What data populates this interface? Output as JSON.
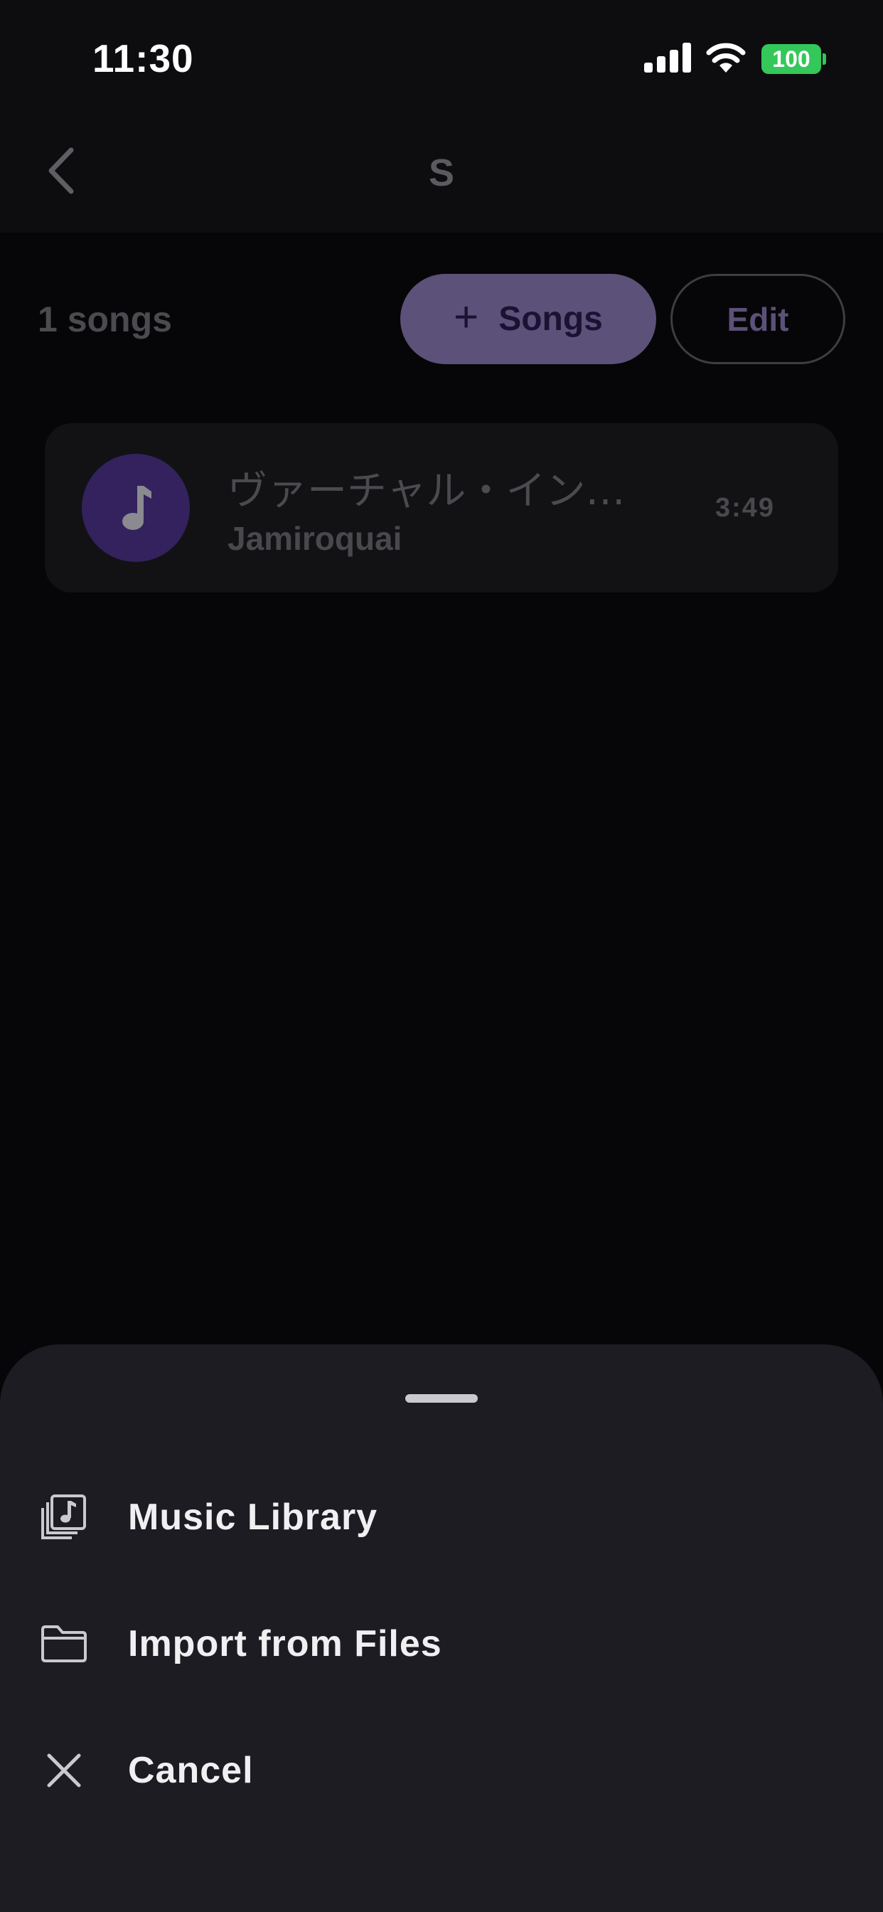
{
  "status_bar": {
    "time": "11:30",
    "battery": "100",
    "battery_color": "#34c759"
  },
  "nav": {
    "title": "S",
    "back_icon": "chevron-left-icon"
  },
  "toolbar": {
    "song_count": "1 songs",
    "add_songs_label": "Songs",
    "add_songs_icon": "plus-icon",
    "edit_label": "Edit",
    "accent": "#5c5178"
  },
  "songs": [
    {
      "title": "ヴァーチャル・イン…",
      "artist": "Jamiroquai",
      "duration": "3:49",
      "artwork_icon": "music-note-icon"
    }
  ],
  "sheet": {
    "items": [
      {
        "label": "Music Library",
        "icon": "music-library-icon"
      },
      {
        "label": "Import from Files",
        "icon": "folder-icon"
      },
      {
        "label": "Cancel",
        "icon": "close-icon"
      }
    ]
  }
}
